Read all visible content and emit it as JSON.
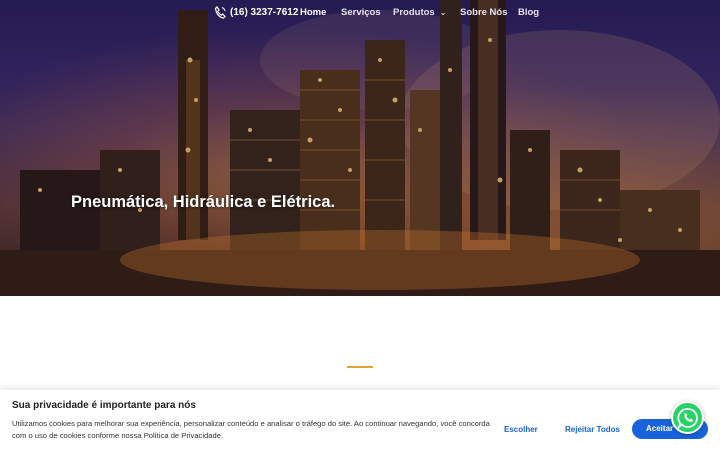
{
  "nav": {
    "phone": "(16) 3237-7612",
    "items": [
      {
        "label": "Home",
        "active": true
      },
      {
        "label": "Serviços"
      },
      {
        "label": "Produtos",
        "has_dropdown": true
      },
      {
        "label": "Sobre Nós"
      },
      {
        "label": "Blog"
      }
    ]
  },
  "hero": {
    "title": "Pneumática, Hidráulica e Elétrica."
  },
  "cookie_banner": {
    "title": "Sua privacidade é importante para nós",
    "text": "Utilizamos cookies para melhorar sua experiência, personalizar conteúdo e analisar o tráfego do site. Ao continuar navegando, você concorda com o uso de cookies conforme nossa Política de Privacidade.",
    "choose_label": "Escolher",
    "reject_label": "Rejeitar Todos",
    "accept_label": "Aceitar"
  },
  "icons": {
    "phone": "phone-icon",
    "dropdown": "chevron-down-icon",
    "whatsapp": "whatsapp-icon"
  },
  "colors": {
    "accent": "#e2a53a",
    "primary_button": "#1863dc",
    "whatsapp": "#25d366"
  }
}
